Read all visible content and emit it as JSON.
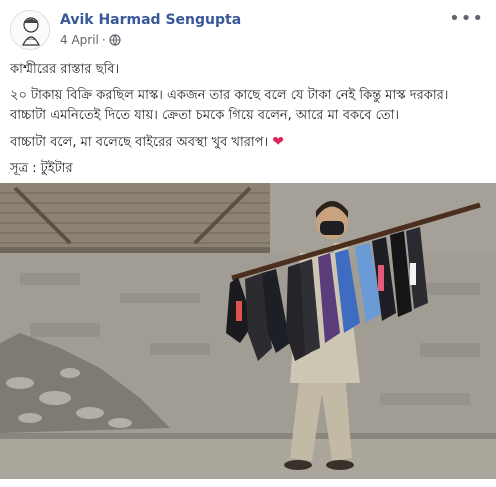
{
  "post": {
    "author": "Avik Harmad Sengupta",
    "date": "4 April",
    "separator": "·",
    "privacy_icon": "globe-icon",
    "more_icon": "more-options-icon",
    "more_glyph": "•••",
    "lines": {
      "line1": "কাশ্মীরের রাস্তার ছবি।",
      "line2a": "২০ টাকায় বিক্রি করছিল মাস্ক। একজন তার কাছে বলে যে টাকা নেই কিন্তু মাস্ক দরকার।",
      "line2b": "বাচ্চাটা এমনিতেই দিতে যায়। ক্রেতা চমকে গিয়ে বলেন, আরে মা বকবে তো।",
      "line3": "বাচ্চাটা বলে, মা বলেছে বাইরের অবস্থা খুব খারাপ।",
      "line4": "সূত্র : টুইটার"
    },
    "heart_glyph": "❤"
  },
  "colors": {
    "author": "#385898",
    "meta": "#606770",
    "heart": "#e0245e"
  }
}
